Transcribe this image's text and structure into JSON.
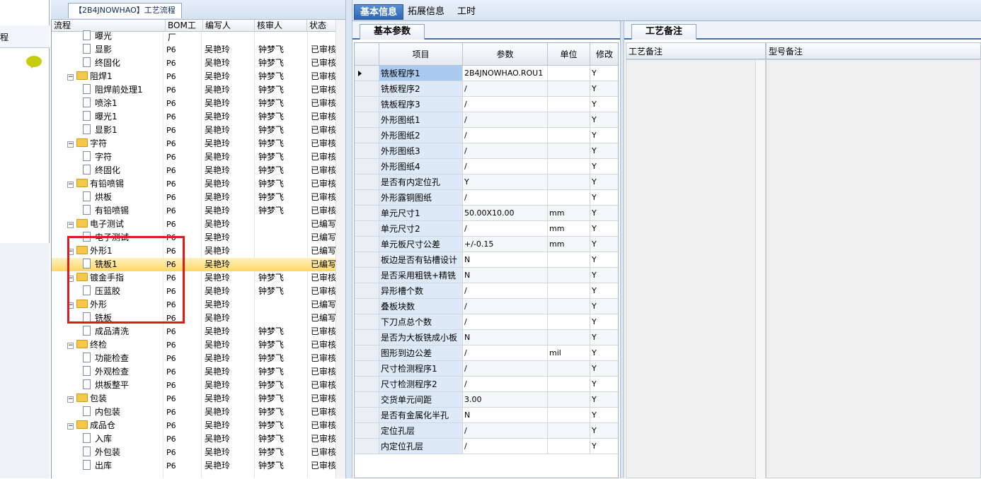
{
  "left_strip": {
    "label": "程"
  },
  "tree_tab": {
    "title": "【2B4JNOWHAO】工艺流程"
  },
  "tree_headers": [
    "流程",
    "BOM工厂",
    "编写人",
    "核审人",
    "状态"
  ],
  "tree_rows": [
    {
      "name": "曝光",
      "level": 2,
      "type": "doc",
      "bom": "",
      "writer": "",
      "reviewer": "",
      "status": ""
    },
    {
      "name": "显影",
      "level": 2,
      "type": "doc",
      "bom": "P6",
      "writer": "吴艳玲",
      "reviewer": "钟梦飞",
      "status": "已审核"
    },
    {
      "name": "终固化",
      "level": 2,
      "type": "doc",
      "bom": "P6",
      "writer": "吴艳玲",
      "reviewer": "钟梦飞",
      "status": "已审核"
    },
    {
      "name": "阻焊1",
      "level": 1,
      "type": "folder",
      "bom": "P6",
      "writer": "吴艳玲",
      "reviewer": "钟梦飞",
      "status": "已审核"
    },
    {
      "name": "阻焊前处理1",
      "level": 2,
      "type": "doc",
      "bom": "P6",
      "writer": "吴艳玲",
      "reviewer": "钟梦飞",
      "status": "已审核"
    },
    {
      "name": "喷涂1",
      "level": 2,
      "type": "doc",
      "bom": "P6",
      "writer": "吴艳玲",
      "reviewer": "钟梦飞",
      "status": "已审核"
    },
    {
      "name": "曝光1",
      "level": 2,
      "type": "doc",
      "bom": "P6",
      "writer": "吴艳玲",
      "reviewer": "钟梦飞",
      "status": "已审核"
    },
    {
      "name": "显影1",
      "level": 2,
      "type": "doc",
      "bom": "P6",
      "writer": "吴艳玲",
      "reviewer": "钟梦飞",
      "status": "已审核"
    },
    {
      "name": "字符",
      "level": 1,
      "type": "folder",
      "bom": "P6",
      "writer": "吴艳玲",
      "reviewer": "钟梦飞",
      "status": "已审核"
    },
    {
      "name": "字符",
      "level": 2,
      "type": "doc",
      "bom": "P6",
      "writer": "吴艳玲",
      "reviewer": "钟梦飞",
      "status": "已审核"
    },
    {
      "name": "终固化",
      "level": 2,
      "type": "doc",
      "bom": "P6",
      "writer": "吴艳玲",
      "reviewer": "钟梦飞",
      "status": "已审核"
    },
    {
      "name": "有铅喷锡",
      "level": 1,
      "type": "folder",
      "bom": "P6",
      "writer": "吴艳玲",
      "reviewer": "钟梦飞",
      "status": "已审核"
    },
    {
      "name": "烘板",
      "level": 2,
      "type": "doc",
      "bom": "P6",
      "writer": "吴艳玲",
      "reviewer": "钟梦飞",
      "status": "已审核"
    },
    {
      "name": "有铅喷锡",
      "level": 2,
      "type": "doc",
      "bom": "P6",
      "writer": "吴艳玲",
      "reviewer": "钟梦飞",
      "status": "已审核"
    },
    {
      "name": "电子测试",
      "level": 1,
      "type": "folder",
      "bom": "P6",
      "writer": "吴艳玲",
      "reviewer": "",
      "status": "已编写"
    },
    {
      "name": "电子测试",
      "level": 2,
      "type": "doc",
      "bom": "P6",
      "writer": "吴艳玲",
      "reviewer": "",
      "status": "已编写"
    },
    {
      "name": "外形1",
      "level": 1,
      "type": "folder",
      "bom": "P6",
      "writer": "吴艳玲",
      "reviewer": "",
      "status": "已编写"
    },
    {
      "name": "铣板1",
      "level": 2,
      "type": "doc",
      "bom": "P6",
      "writer": "吴艳玲",
      "reviewer": "",
      "status": "已编写",
      "selected": true
    },
    {
      "name": "镀金手指",
      "level": 1,
      "type": "folder",
      "bom": "P6",
      "writer": "吴艳玲",
      "reviewer": "钟梦飞",
      "status": "已审核"
    },
    {
      "name": "压蓝胶",
      "level": 2,
      "type": "doc",
      "bom": "P6",
      "writer": "吴艳玲",
      "reviewer": "钟梦飞",
      "status": "已审核"
    },
    {
      "name": "外形",
      "level": 1,
      "type": "folder",
      "bom": "P6",
      "writer": "吴艳玲",
      "reviewer": "",
      "status": "已编写"
    },
    {
      "name": "铣板",
      "level": 2,
      "type": "doc",
      "bom": "P6",
      "writer": "吴艳玲",
      "reviewer": "",
      "status": "已编写"
    },
    {
      "name": "成品清洗",
      "level": 2,
      "type": "doc",
      "bom": "P6",
      "writer": "吴艳玲",
      "reviewer": "钟梦飞",
      "status": "已审核"
    },
    {
      "name": "终检",
      "level": 1,
      "type": "folder",
      "bom": "P6",
      "writer": "吴艳玲",
      "reviewer": "钟梦飞",
      "status": "已审核"
    },
    {
      "name": "功能检查",
      "level": 2,
      "type": "doc",
      "bom": "P6",
      "writer": "吴艳玲",
      "reviewer": "钟梦飞",
      "status": "已审核"
    },
    {
      "name": "外观检查",
      "level": 2,
      "type": "doc",
      "bom": "P6",
      "writer": "吴艳玲",
      "reviewer": "钟梦飞",
      "status": "已审核"
    },
    {
      "name": "烘板整平",
      "level": 2,
      "type": "doc",
      "bom": "P6",
      "writer": "吴艳玲",
      "reviewer": "钟梦飞",
      "status": "已审核"
    },
    {
      "name": "包装",
      "level": 1,
      "type": "folder",
      "bom": "P6",
      "writer": "吴艳玲",
      "reviewer": "钟梦飞",
      "status": "已审核"
    },
    {
      "name": "内包装",
      "level": 2,
      "type": "doc",
      "bom": "P6",
      "writer": "吴艳玲",
      "reviewer": "钟梦飞",
      "status": "已审核"
    },
    {
      "name": "成品仓",
      "level": 1,
      "type": "folder",
      "bom": "P6",
      "writer": "吴艳玲",
      "reviewer": "钟梦飞",
      "status": "已审核"
    },
    {
      "name": "入库",
      "level": 2,
      "type": "doc",
      "bom": "P6",
      "writer": "吴艳玲",
      "reviewer": "钟梦飞",
      "status": "已审核"
    },
    {
      "name": "外包装",
      "level": 2,
      "type": "doc",
      "bom": "P6",
      "writer": "吴艳玲",
      "reviewer": "钟梦飞",
      "status": "已审核"
    },
    {
      "name": "出库",
      "level": 2,
      "type": "doc",
      "bom": "P6",
      "writer": "吴艳玲",
      "reviewer": "钟梦飞",
      "status": "已审核"
    }
  ],
  "top_tabs": [
    {
      "label": "基本信息",
      "active": true
    },
    {
      "label": "拓展信息",
      "active": false
    },
    {
      "label": "工时",
      "active": false
    }
  ],
  "params_panel": {
    "tab": "基本参数",
    "headers": [
      "项目",
      "参数",
      "单位",
      "修改"
    ]
  },
  "params_rows": [
    {
      "item": "铣板程序1",
      "value": "2B4JNOWHAO.ROU1",
      "unit": "",
      "mod": "Y"
    },
    {
      "item": "铣板程序2",
      "value": "/",
      "unit": "",
      "mod": "Y"
    },
    {
      "item": "铣板程序3",
      "value": "/",
      "unit": "",
      "mod": "Y"
    },
    {
      "item": "外形图纸1",
      "value": "/",
      "unit": "",
      "mod": "Y"
    },
    {
      "item": "外形图纸2",
      "value": "/",
      "unit": "",
      "mod": "Y"
    },
    {
      "item": "外形图纸3",
      "value": "/",
      "unit": "",
      "mod": "Y"
    },
    {
      "item": "外形图纸4",
      "value": "/",
      "unit": "",
      "mod": "Y"
    },
    {
      "item": "是否有内定位孔",
      "value": "Y",
      "unit": "",
      "mod": "Y"
    },
    {
      "item": "外形露铜图纸",
      "value": "/",
      "unit": "",
      "mod": "Y"
    },
    {
      "item": "单元尺寸1",
      "value": "50.00X10.00",
      "unit": "mm",
      "mod": "Y"
    },
    {
      "item": "单元尺寸2",
      "value": "/",
      "unit": "mm",
      "mod": "Y"
    },
    {
      "item": "单元板尺寸公差",
      "value": "+/-0.15",
      "unit": "mm",
      "mod": "Y"
    },
    {
      "item": "板边是否有钻槽设计",
      "value": "N",
      "unit": "",
      "mod": "Y"
    },
    {
      "item": "是否采用粗铣+精铣",
      "value": "N",
      "unit": "",
      "mod": "Y"
    },
    {
      "item": "异形槽个数",
      "value": "/",
      "unit": "",
      "mod": "Y"
    },
    {
      "item": "叠板块数",
      "value": "/",
      "unit": "",
      "mod": "Y"
    },
    {
      "item": "下刀点总个数",
      "value": "/",
      "unit": "",
      "mod": "Y"
    },
    {
      "item": "是否为大板铣成小板",
      "value": "N",
      "unit": "",
      "mod": "Y"
    },
    {
      "item": "图形到边公差",
      "value": "/",
      "unit": "mil",
      "mod": "Y"
    },
    {
      "item": "尺寸检测程序1",
      "value": "/",
      "unit": "",
      "mod": "Y"
    },
    {
      "item": "尺寸检测程序2",
      "value": "/",
      "unit": "",
      "mod": "Y"
    },
    {
      "item": "交货单元间距",
      "value": "3.00",
      "unit": "",
      "mod": "Y"
    },
    {
      "item": "是否有金属化半孔",
      "value": "N",
      "unit": "",
      "mod": "Y"
    },
    {
      "item": "定位孔层",
      "value": "/",
      "unit": "",
      "mod": "Y"
    },
    {
      "item": "内定位孔层",
      "value": "/",
      "unit": "",
      "mod": "Y"
    }
  ],
  "notes_panel": {
    "tab": "工艺备注",
    "col1": "工艺备注",
    "col2": "型号备注"
  }
}
